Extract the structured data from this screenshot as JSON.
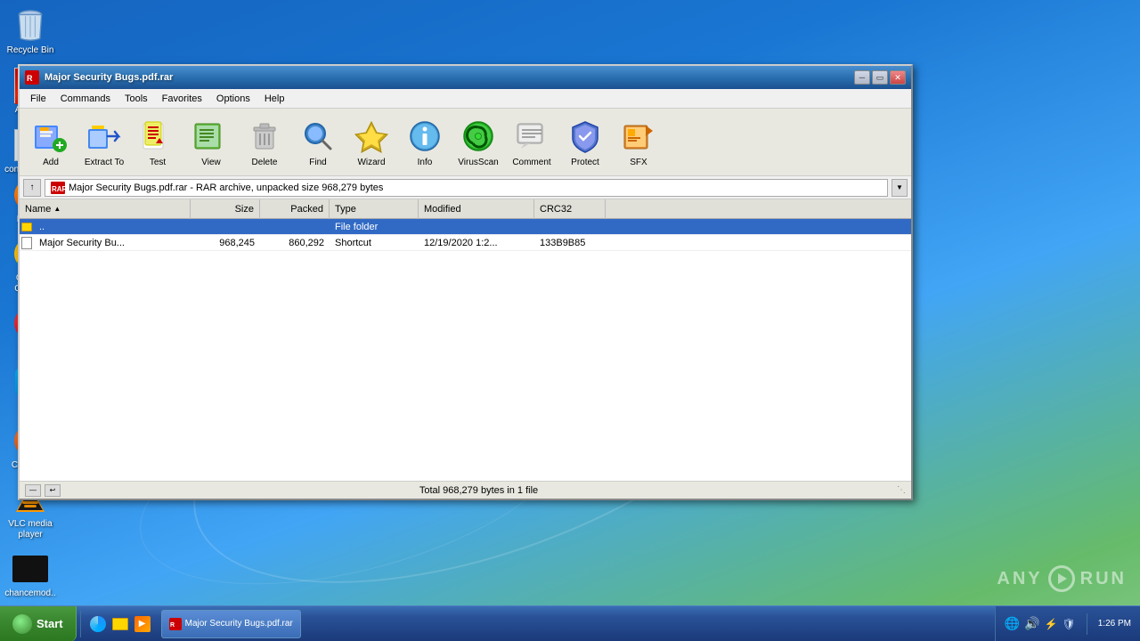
{
  "desktop": {
    "icons": [
      {
        "id": "recycle-bin",
        "label": "Recycle Bin",
        "type": "recycle"
      },
      {
        "id": "acrobat",
        "label": "Acrobat",
        "type": "acrobat"
      },
      {
        "id": "concollectio",
        "label": "concollectio...",
        "type": "generic"
      }
    ],
    "bottom_icons": [
      {
        "id": "firefox",
        "label": "Firefox",
        "type": "firefox"
      },
      {
        "id": "google-chrome",
        "label": "Google Chrome",
        "type": "chrome"
      },
      {
        "id": "opera",
        "label": "Opera",
        "type": "opera"
      },
      {
        "id": "skype",
        "label": "Skype",
        "type": "skype"
      },
      {
        "id": "ccleaner",
        "label": "CCleaner",
        "type": "ccleaner"
      },
      {
        "id": "vlc",
        "label": "VLC media player",
        "type": "vlc"
      },
      {
        "id": "chancemodi",
        "label": "chancemod...",
        "type": "chancemodi"
      }
    ]
  },
  "winrar": {
    "title": "Major Security Bugs.pdf.rar",
    "menu": [
      "File",
      "Commands",
      "Tools",
      "Favorites",
      "Options",
      "Help"
    ],
    "toolbar_buttons": [
      {
        "id": "add",
        "label": "Add"
      },
      {
        "id": "extract-to",
        "label": "Extract To"
      },
      {
        "id": "test",
        "label": "Test"
      },
      {
        "id": "view",
        "label": "View"
      },
      {
        "id": "delete",
        "label": "Delete"
      },
      {
        "id": "find",
        "label": "Find"
      },
      {
        "id": "wizard",
        "label": "Wizard"
      },
      {
        "id": "info",
        "label": "Info"
      },
      {
        "id": "virusscan",
        "label": "VirusScan"
      },
      {
        "id": "comment",
        "label": "Comment"
      },
      {
        "id": "protect",
        "label": "Protect"
      },
      {
        "id": "sfx",
        "label": "SFX"
      }
    ],
    "address": "Major Security Bugs.pdf.rar - RAR archive, unpacked size 968,279 bytes",
    "columns": [
      {
        "id": "name",
        "label": "Name"
      },
      {
        "id": "size",
        "label": "Size"
      },
      {
        "id": "packed",
        "label": "Packed"
      },
      {
        "id": "type",
        "label": "Type"
      },
      {
        "id": "modified",
        "label": "Modified"
      },
      {
        "id": "crc32",
        "label": "CRC32"
      }
    ],
    "files": [
      {
        "name": "..",
        "size": "",
        "packed": "",
        "type": "File folder",
        "modified": "",
        "crc32": "",
        "is_up": true,
        "selected": true
      },
      {
        "name": "Major Security Bu...",
        "size": "968,245",
        "packed": "860,292",
        "type": "Shortcut",
        "modified": "12/19/2020 1:2...",
        "crc32": "133B9B85",
        "is_up": false,
        "selected": false
      }
    ],
    "status_text": "Total 968,279 bytes in 1 file"
  },
  "taskbar": {
    "start_label": "Start",
    "apps": [
      {
        "label": "Major Security Bugs.pdf.rar",
        "icon": "📦"
      }
    ],
    "tray_icons": [
      "🔊",
      "🌐",
      "⚡",
      "🔒"
    ],
    "time": "1:26 PM",
    "date": ""
  },
  "anyrun": {
    "text": "ANY",
    "text2": "RUN"
  }
}
